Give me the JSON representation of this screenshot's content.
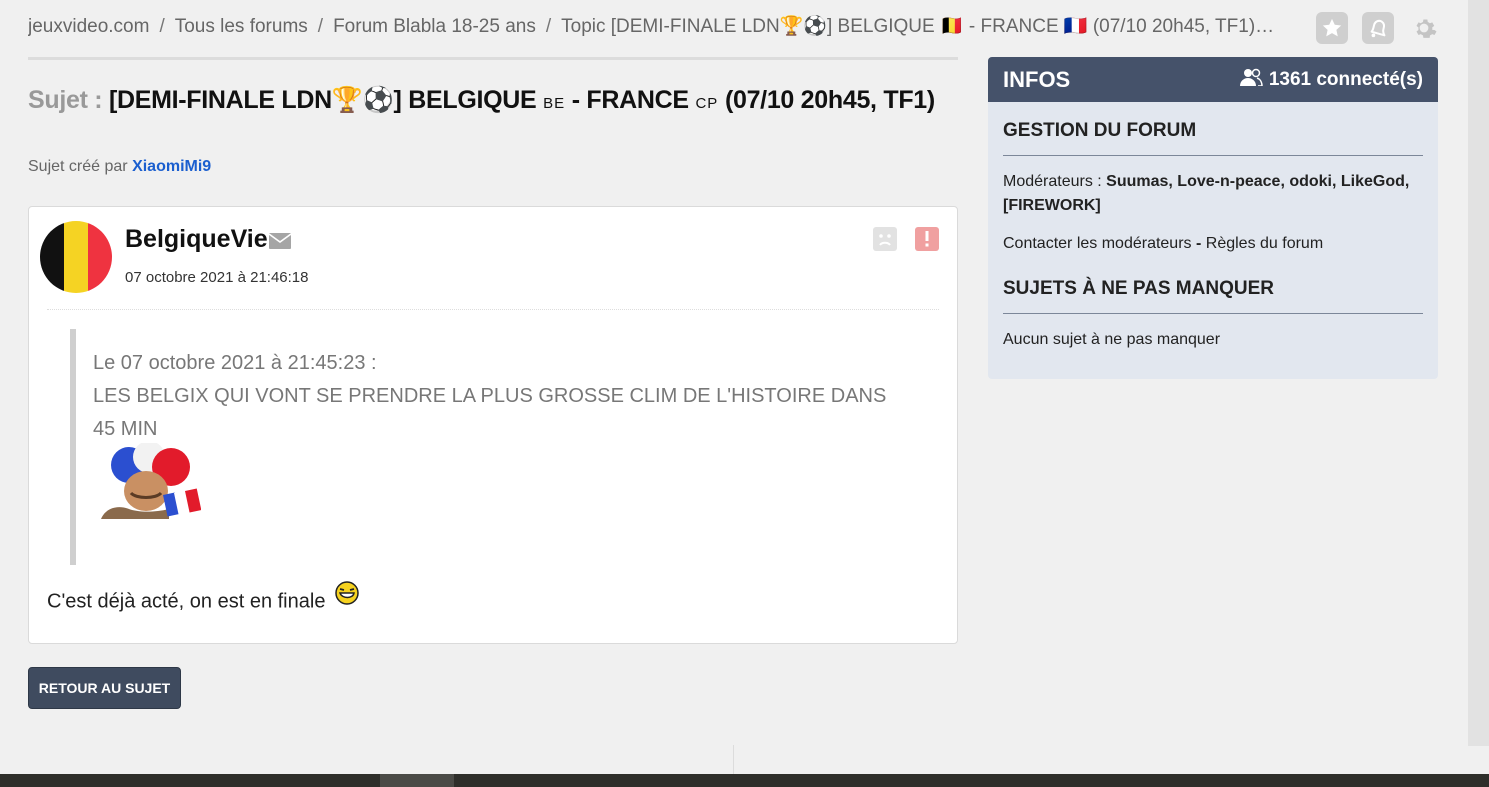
{
  "breadcrumb": {
    "items": [
      "jeuxvideo.com",
      "Tous les forums",
      "Forum Blabla 18-25 ans",
      "Topic [DEMI-FINALE LDN🏆⚽] BELGIQUE 🇧🇪 - FRANCE 🇨🇵 (07/10 20h45, TF1)…"
    ],
    "separator": "/"
  },
  "top_icons": [
    "star-icon",
    "bell-icon",
    "gear-icon"
  ],
  "topic": {
    "prefix": "Sujet :",
    "title_a": "[DEMI-FINALE LDN🏆⚽] BELGIQUE",
    "flag_a": "BE",
    "title_b": "- FRANCE",
    "flag_b": "CP",
    "title_c": "(07/10 20h45, TF1)"
  },
  "creator": {
    "label": "Sujet créé par",
    "name": "XiaomiMi9"
  },
  "post": {
    "author": "BelgiqueVie",
    "date": "07 octobre 2021 à 21:46:18",
    "quote": {
      "header": "Le 07 octobre 2021 à 21:45:23 :",
      "text": "LES BELGIX QUI VONT SE PRENDRE LA PLUS GROSSE CLIM DE L'HISTOIRE DANS 45 MIN"
    },
    "message": "C'est déjà acté, on est en finale"
  },
  "back_button": "RETOUR AU SUJET",
  "infos": {
    "title": "INFOS",
    "connected": "1361 connecté(s)",
    "gestion_title": "GESTION DU FORUM",
    "moderators_label": "Modérateurs :",
    "moderators": "Suumas, Love-n-peace, odoki, LikeGod, [FIREWORK]",
    "contact": "Contacter les modérateurs",
    "dash": "-",
    "rules": "Règles du forum",
    "sujets_title": "SUJETS À NE PAS MANQUER",
    "no_sujet": "Aucun sujet à ne pas manquer"
  },
  "colors": {
    "accent": "#45526a",
    "link": "#1b5fcf",
    "alert": "#f0a0a0",
    "belgium": [
      "#111111",
      "#f5d323",
      "#ef3340"
    ]
  }
}
